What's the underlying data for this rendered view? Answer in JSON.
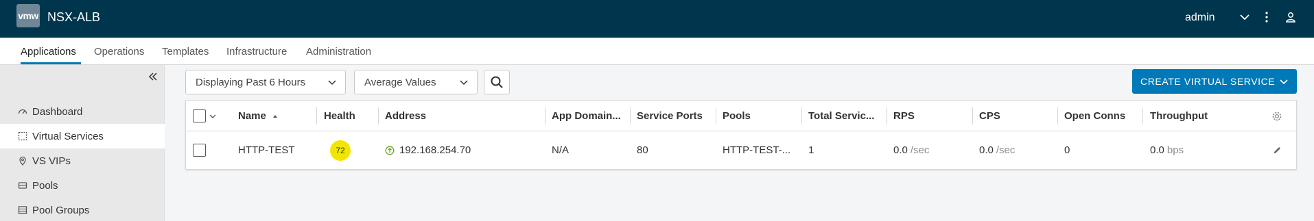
{
  "header": {
    "logo_text": "vmw",
    "title": "NSX-ALB",
    "user": "admin",
    "icons": [
      "chevron-down-icon",
      "more-vertical-icon",
      "user-icon"
    ]
  },
  "nav": {
    "tabs": [
      {
        "label": "Applications",
        "active": true
      },
      {
        "label": "Operations"
      },
      {
        "label": "Templates"
      },
      {
        "label": "Infrastructure"
      },
      {
        "label": "Administration"
      }
    ]
  },
  "sidebar": {
    "items": [
      {
        "label": "Dashboard",
        "icon": "dashboard-icon"
      },
      {
        "label": "Virtual Services",
        "icon": "virtual-services-icon",
        "active": true
      },
      {
        "label": "VS VIPs",
        "icon": "location-pin-icon"
      },
      {
        "label": "Pools",
        "icon": "pool-icon"
      },
      {
        "label": "Pool Groups",
        "icon": "pool-groups-icon"
      }
    ]
  },
  "toolbar": {
    "time_range": "Displaying Past 6 Hours",
    "metric_mode": "Average Values",
    "create_label": "CREATE VIRTUAL SERVICE"
  },
  "table": {
    "columns": [
      "Name",
      "Health",
      "Address",
      "App Domain...",
      "Service Ports",
      "Pools",
      "Total Servic...",
      "RPS",
      "CPS",
      "Open Conns",
      "Throughput"
    ],
    "sorted_column": "Name",
    "rows": [
      {
        "name": "HTTP-TEST",
        "health": "72",
        "health_color": "#f2e600",
        "address": "192.168.254.70",
        "app_domain": "N/A",
        "service_ports": "80",
        "pools": "HTTP-TEST-...",
        "total_services": "1",
        "rps": "0.0",
        "rps_unit": "/sec",
        "cps": "0.0",
        "cps_unit": "/sec",
        "open_conns": "0",
        "throughput": "0.0",
        "throughput_unit": "bps"
      }
    ]
  },
  "colors": {
    "header_bg": "#00364d",
    "accent": "#0079b8",
    "health_warning": "#f2e600",
    "status_up": "#62a420"
  }
}
